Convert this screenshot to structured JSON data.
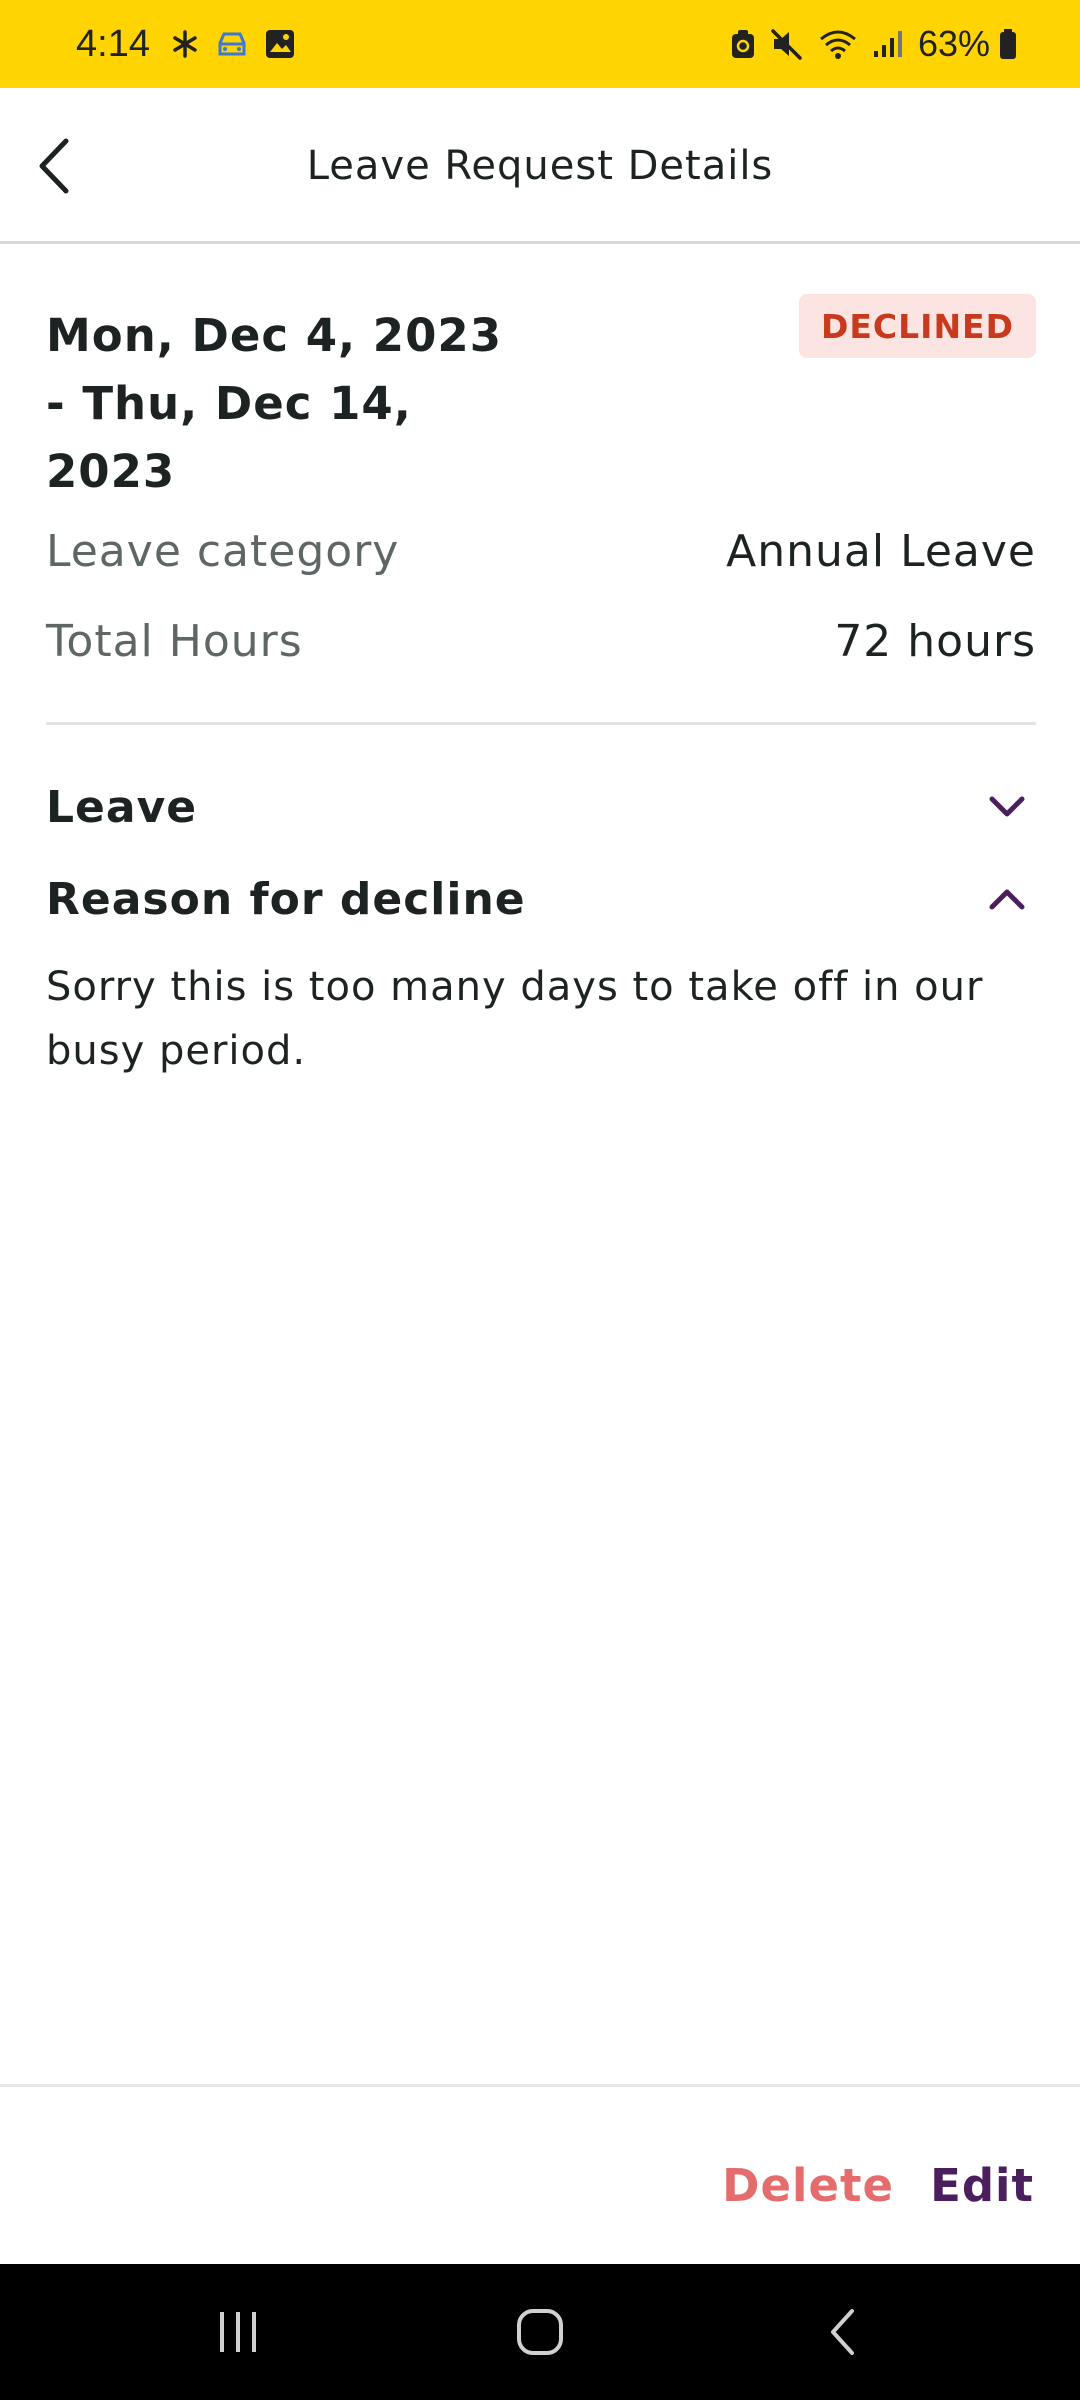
{
  "status_bar": {
    "time": "4:14",
    "battery": "63%",
    "background_color": "#ffd400",
    "icons": [
      "asterisk-icon",
      "car-icon",
      "image-icon",
      "lock-battery-icon",
      "mute-icon",
      "wifi-icon",
      "signal-icon",
      "battery-icon"
    ]
  },
  "header": {
    "title": "Leave Request Details",
    "back_icon": "chevron-left-icon"
  },
  "summary": {
    "date_line1": "Mon, Dec 4, 2023",
    "date_line2": "- Thu, Dec 14,",
    "date_line3": "2023",
    "status": "DECLINED",
    "status_color": "#c83a1e",
    "status_bg": "#fbe4e1",
    "category_label": "Leave category",
    "category_value": "Annual Leave",
    "hours_label": "Total Hours",
    "hours_value": "72 hours"
  },
  "sections": {
    "leave_title": "Leave",
    "leave_expanded": false,
    "reason_title": "Reason for decline",
    "reason_expanded": true,
    "reason_text": "Sorry this is too many days to take off in our busy period."
  },
  "actions": {
    "delete_label": "Delete",
    "delete_color": "#e56c6c",
    "edit_label": "Edit",
    "edit_color": "#4b1f5e"
  },
  "nav_bar": {
    "icons": [
      "recents-icon",
      "home-icon",
      "back-icon"
    ]
  }
}
